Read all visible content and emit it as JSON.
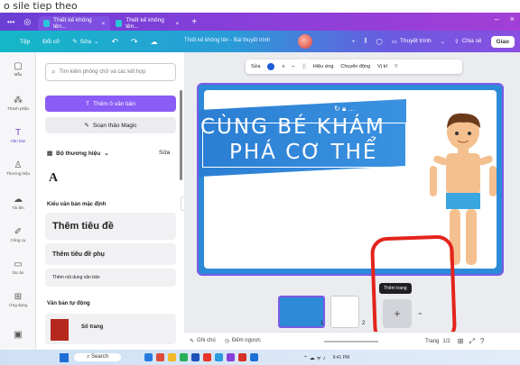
{
  "top_fragment": "o sile tiep theo",
  "tabs": [
    {
      "label": "Thiết kế không tên..."
    },
    {
      "label": "Thiết kế không tên..."
    }
  ],
  "toolbar": {
    "home": "Tệp",
    "resize": "Đổi cỡ",
    "edit": "Sửa",
    "doc_title": "Thiết kế không tên - Bài thuyết trình",
    "present": "Thuyết trình",
    "share": "Chia sẻ",
    "giao": "Giao"
  },
  "rail": {
    "items": [
      {
        "label": "Mẫu",
        "icon": "template-icon"
      },
      {
        "label": "Thành phần",
        "icon": "elements-icon"
      },
      {
        "label": "Văn bản",
        "icon": "text-icon"
      },
      {
        "label": "Thương hiệu",
        "icon": "brand-icon"
      },
      {
        "label": "Tải lên",
        "icon": "upload-icon"
      },
      {
        "label": "Công cụ",
        "icon": "tools-icon"
      },
      {
        "label": "Dự án",
        "icon": "projects-icon"
      },
      {
        "label": "Ứng dụng",
        "icon": "apps-icon"
      }
    ]
  },
  "panel": {
    "search_placeholder": "Tìm kiếm phông chữ và các kết hợp",
    "add_text": "Thêm ô văn bản",
    "magic": "Soạn thảo Magic",
    "brand_kit": "Bộ thương hiệu",
    "brand_edit": "Sửa",
    "default_styles": "Kiểu văn bản mặc định",
    "heading": "Thêm tiêu đề",
    "subheading": "Thêm tiêu đề phụ",
    "body": "Thêm nội dung văn bản",
    "dynamic": "Văn bản tự động",
    "page_numbers": "Số trang"
  },
  "context_toolbar": {
    "edit": "Sửa",
    "effects": "Hiệu ứng",
    "animate": "Chuyển động",
    "position": "Vị trí"
  },
  "slide": {
    "title_line1": "CÙNG BÉ KHÁM",
    "title_line2": "PHÁ CƠ THỂ"
  },
  "pages": {
    "tooltip": "Thêm trang",
    "page1_num": "1",
    "page2_num": "2"
  },
  "statusbar": {
    "notes": "Ghi chú",
    "timer": "Đếm ngược",
    "pages_label": "Trang",
    "page_count": "1/2"
  },
  "taskbar": {
    "search": "Search",
    "time": "9:41 PM"
  },
  "colors": {
    "tab_purple": "#7e4fe0",
    "toolbar_teal": "#14b8c6",
    "slide_blue": "#2c8ad8",
    "accent_violet": "#8b5cf6",
    "red_annotation": "#e3241c"
  }
}
